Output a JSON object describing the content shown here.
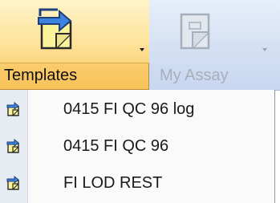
{
  "ribbon": {
    "templates_label": "Templates",
    "templates_icon": "template-document-icon",
    "myassay_label": "My Assay",
    "myassay_icon": "assay-document-icon"
  },
  "menu": {
    "items": [
      {
        "label": "0415 FI QC 96 log",
        "icon": "template-document-icon"
      },
      {
        "label": "0415 FI QC 96",
        "icon": "template-document-icon"
      },
      {
        "label": "FI LOD REST",
        "icon": "template-document-icon"
      }
    ]
  },
  "colors": {
    "ribbon_bg": "#d4e0f3",
    "active_button": "#fcd680",
    "disabled_text": "#a7afbb",
    "menu_text": "#1a1a1a"
  }
}
